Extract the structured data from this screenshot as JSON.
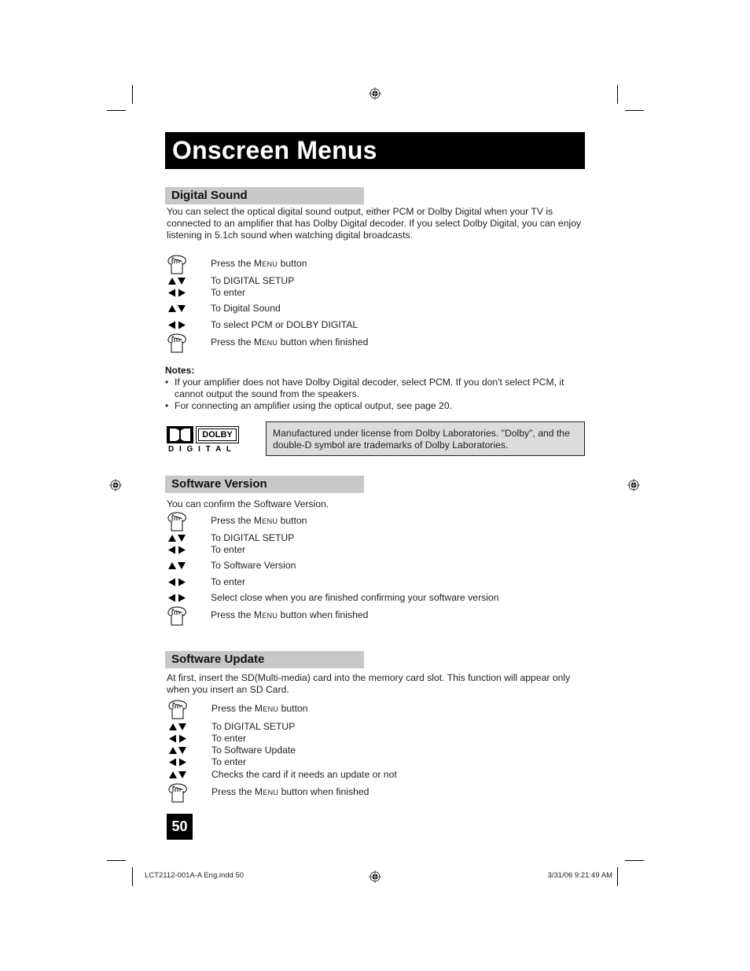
{
  "page": {
    "title": "Onscreen Menus",
    "page_number": "50"
  },
  "sections": {
    "digital_sound": {
      "heading": "Digital Sound",
      "intro": "You can select the optical digital sound output, either PCM or Dolby Digital when your TV is connected to an amplifier that has Dolby Digital decoder.  If you select Dolby Digital, you can enjoy listening in 5.1ch sound when watching digital broadcasts.",
      "steps": [
        {
          "icon": "menu-hand-icon",
          "pre": "Press the ",
          "sc": "Menu",
          "post": " button"
        },
        {
          "icon": "up-down-arrows-icon",
          "pre": "To DIGITAL SETUP",
          "sc": "",
          "post": ""
        },
        {
          "icon": "left-right-arrows-icon",
          "pre": "To enter",
          "sc": "",
          "post": ""
        },
        {
          "icon": "up-down-arrows-icon",
          "pre": "To Digital Sound",
          "sc": "",
          "post": ""
        },
        {
          "icon": "left-right-arrows-icon",
          "pre": "To select PCM or DOLBY DIGITAL",
          "sc": "",
          "post": ""
        },
        {
          "icon": "menu-hand-icon",
          "pre": "Press the ",
          "sc": "Menu",
          "post": " button when finished"
        }
      ],
      "notes_title": "Notes:",
      "notes": [
        "If your amplifier does not have Dolby Digital decoder, select PCM.  If you don't select PCM, it cannot output the sound from the speakers.",
        "For connecting an amplifier using the optical output, see page 20."
      ],
      "bullet_char": "•",
      "dolby_logo": {
        "word": "DOLBY",
        "sub": "D I G I T A L"
      },
      "license_text": "Manufactured under license from Dolby Laboratories.  \"Dolby\", and the double-D symbol are trademarks of Dolby Laboratories."
    },
    "software_version": {
      "heading": "Software Version",
      "intro": "You can confirm the Software Version.",
      "steps": [
        {
          "icon": "menu-hand-icon",
          "pre": "Press the ",
          "sc": "Menu",
          "post": " button"
        },
        {
          "icon": "up-down-arrows-icon",
          "pre": "To DIGITAL SETUP",
          "sc": "",
          "post": ""
        },
        {
          "icon": "left-right-arrows-icon",
          "pre": "To enter",
          "sc": "",
          "post": ""
        },
        {
          "icon": "up-down-arrows-icon",
          "pre": "To Software Version",
          "sc": "",
          "post": ""
        },
        {
          "icon": "left-right-arrows-icon",
          "pre": "To enter",
          "sc": "",
          "post": ""
        },
        {
          "icon": "left-right-arrows-icon",
          "pre": "Select close when you are finished confirming your software version",
          "sc": "",
          "post": ""
        },
        {
          "icon": "menu-hand-icon",
          "pre": "Press the ",
          "sc": "Menu",
          "post": " button when finished"
        }
      ]
    },
    "software_update": {
      "heading": "Software Update",
      "intro": "At first, insert the SD(Multi-media) card into the memory card slot.  This function will appear only when you insert an SD Card.",
      "steps": [
        {
          "icon": "menu-hand-icon",
          "pre": "Press the ",
          "sc": "Menu",
          "post": " button"
        },
        {
          "icon": "up-down-arrows-icon",
          "pre": "To DIGITAL SETUP",
          "sc": "",
          "post": ""
        },
        {
          "icon": "left-right-arrows-icon",
          "pre": "To enter",
          "sc": "",
          "post": ""
        },
        {
          "icon": "up-down-arrows-icon",
          "pre": "To Software Update",
          "sc": "",
          "post": ""
        },
        {
          "icon": "left-right-arrows-icon",
          "pre": "To enter",
          "sc": "",
          "post": ""
        },
        {
          "icon": "up-down-arrows-icon",
          "pre": "Checks the card if it needs an update or not",
          "sc": "",
          "post": ""
        },
        {
          "icon": "menu-hand-icon",
          "pre": "Press the ",
          "sc": "Menu",
          "post": " button when finished"
        }
      ]
    }
  },
  "footer": {
    "file_name": "LCT2112-001A-A Eng.indd   50",
    "timestamp": "3/31/06   9:21:49 AM"
  }
}
